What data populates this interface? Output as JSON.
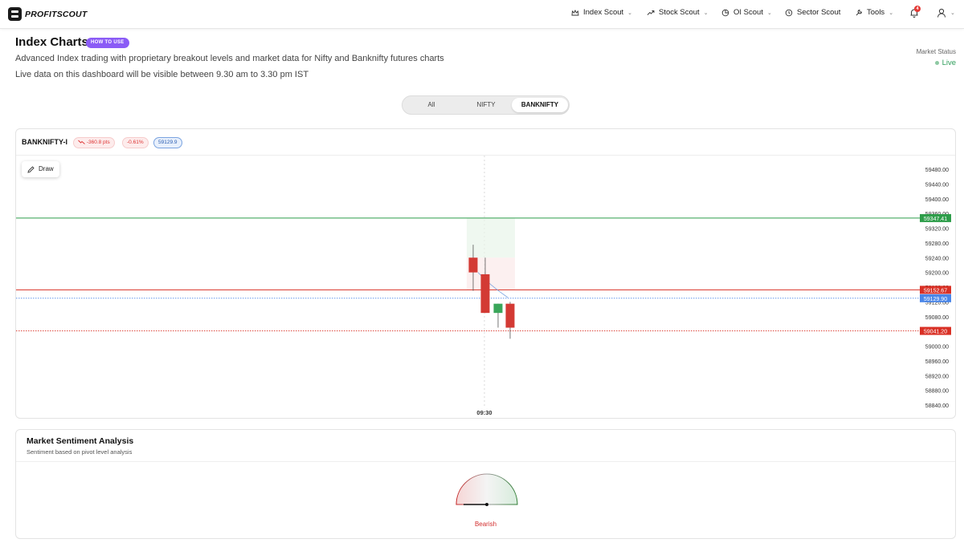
{
  "nav": {
    "brand": "PROFITSCOUT",
    "items": [
      {
        "label": "Index Scout",
        "icon": "crown-icon",
        "dropdown": true
      },
      {
        "label": "Stock Scout",
        "icon": "trend-up-icon",
        "dropdown": true
      },
      {
        "label": "OI Scout",
        "icon": "pie-chart-icon",
        "dropdown": true
      },
      {
        "label": "Sector Scout",
        "icon": "clock-icon",
        "dropdown": false
      },
      {
        "label": "Tools",
        "icon": "wrench-icon",
        "dropdown": true
      }
    ],
    "notification_count": "4"
  },
  "header": {
    "title": "Index Charts",
    "how_to_use": "HOW TO USE",
    "subtitle": "Advanced Index trading with proprietary breakout levels and market data for Nifty and Banknifty futures charts",
    "live_info": "Live data on this dashboard will be visible between 9.30 am to 3.30 pm IST",
    "market_status_label": "Market Status",
    "market_status_value": "Live"
  },
  "tabs": {
    "items": [
      "All",
      "NIFTY",
      "BANKNIFTY"
    ],
    "active": "BANKNIFTY"
  },
  "chart_card": {
    "symbol": "BANKNIFTY-I",
    "change_pts": "-360.8 pts",
    "change_pct": "-0.61%",
    "ltp": "59129.9",
    "draw_label": "Draw"
  },
  "chart_data": {
    "type": "candlestick",
    "x_label": "09:30",
    "y_ticks": [
      "59480.00",
      "59440.00",
      "59400.00",
      "59360.00",
      "59320.00",
      "59280.00",
      "59240.00",
      "59200.00",
      "59160.00",
      "59120.00",
      "59080.00",
      "59000.00",
      "58960.00",
      "58920.00",
      "58880.00",
      "58840.00"
    ],
    "ylim": [
      58840,
      59480
    ],
    "candles": [
      {
        "open": 59240,
        "close": 59200,
        "high": 59275,
        "low": 59150
      },
      {
        "open": 59195,
        "close": 59090,
        "high": 59240,
        "low": 59090
      },
      {
        "open": 59090,
        "close": 59115,
        "high": 59115,
        "low": 59050
      },
      {
        "open": 59115,
        "close": 59050,
        "high": 59120,
        "low": 59020
      }
    ],
    "levels": [
      {
        "label": "59347.41",
        "value": 59347.41,
        "color": "#2e9d4a",
        "style": "solid"
      },
      {
        "label": "59152.67",
        "value": 59152.67,
        "color": "#d93025",
        "style": "solid"
      },
      {
        "label": "59129.90",
        "value": 59129.9,
        "color": "#4a86e8",
        "style": "dotted"
      },
      {
        "label": "59041.20",
        "value": 59041.2,
        "color": "#d93025",
        "style": "dotted"
      }
    ],
    "colors": {
      "up": "#3aa65a",
      "down": "#d33a34"
    }
  },
  "sentiment": {
    "title": "Market Sentiment Analysis",
    "subtitle": "Sentiment based on pivot level analysis",
    "value": "Bearish"
  }
}
